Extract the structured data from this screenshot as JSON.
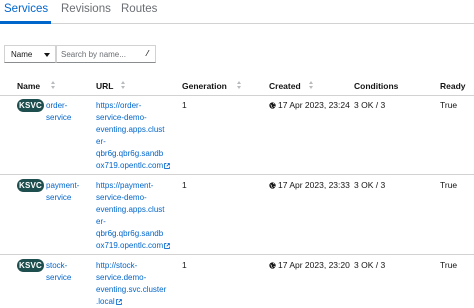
{
  "tabs": [
    {
      "label": "Services",
      "active": true
    },
    {
      "label": "Revisions",
      "active": false
    },
    {
      "label": "Routes",
      "active": false
    }
  ],
  "filter": {
    "selected": "Name",
    "placeholder": "Search by name...",
    "shortcut": "/"
  },
  "columns": [
    "Name",
    "URL",
    "Generation",
    "Created",
    "Conditions",
    "Ready"
  ],
  "rows": [
    {
      "badge": "KSVC",
      "name_lines": [
        "order-",
        "service"
      ],
      "url_lines": [
        "https://order-",
        "service-demo-",
        "eventing.apps.clust",
        "er-",
        "qbr6g.qbr6g.sandb",
        "ox719.opentlc.com"
      ],
      "generation": "1",
      "created": "17 Apr 2023, 23:24",
      "conditions": "3 OK / 3",
      "ready": "True"
    },
    {
      "badge": "KSVC",
      "name_lines": [
        "payment-",
        "service"
      ],
      "url_lines": [
        "https://payment-",
        "service-demo-",
        "eventing.apps.clust",
        "er-",
        "qbr6g.qbr6g.sandb",
        "ox719.opentlc.com"
      ],
      "generation": "1",
      "created": "17 Apr 2023, 23:33",
      "conditions": "3 OK / 3",
      "ready": "True"
    },
    {
      "badge": "KSVC",
      "name_lines": [
        "stock-",
        "service"
      ],
      "url_lines": [
        "http://stock-",
        "service.demo-",
        "eventing.svc.cluster",
        ".local"
      ],
      "generation": "1",
      "created": "17 Apr 2023, 23:20",
      "conditions": "3 OK / 3",
      "ready": "True"
    }
  ],
  "icons": {
    "created": "globe-icon",
    "url": "external-link-icon",
    "filter": "caret-down-icon",
    "sort": "sort-icon"
  },
  "colors": {
    "accent": "#0066cc",
    "badge": "#1e4f4e"
  }
}
